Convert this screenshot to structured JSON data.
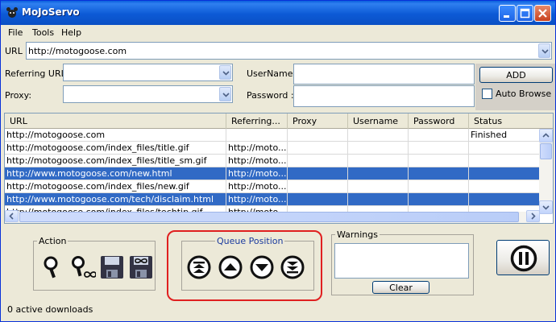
{
  "window": {
    "title": "MoJoServo"
  },
  "menu": [
    "File",
    "Tools",
    "Help"
  ],
  "url_bar": {
    "label": "URL :",
    "value": "http://motogoose.com"
  },
  "form": {
    "referring_url_label": "Referring URL:",
    "proxy_label": "Proxy:",
    "username_label": "UserName :",
    "password_label": "Password :",
    "referring_url_value": "",
    "proxy_value": "",
    "username_value": "",
    "password_value": "",
    "add_label": "ADD",
    "auto_browse_label": "Auto Browse",
    "auto_browse_checked": false
  },
  "table": {
    "columns": [
      "URL",
      "Referring...",
      "Proxy",
      "Username",
      "Password",
      "Status"
    ],
    "rows": [
      {
        "url": "http://motogoose.com",
        "referring": "",
        "proxy": "",
        "username": "",
        "password": "",
        "status": "Finished",
        "selected": false
      },
      {
        "url": "http://motogoose.com/index_files/title.gif",
        "referring": "http://moto...",
        "proxy": "",
        "username": "",
        "password": "",
        "status": "",
        "selected": false
      },
      {
        "url": "http://motogoose.com/index_files/title_sm.gif",
        "referring": "http://moto...",
        "proxy": "",
        "username": "",
        "password": "",
        "status": "",
        "selected": false
      },
      {
        "url": "http://www.motogoose.com/new.html",
        "referring": "http://moto...",
        "proxy": "",
        "username": "",
        "password": "",
        "status": "",
        "selected": true
      },
      {
        "url": "http://motogoose.com/index_files/new.gif",
        "referring": "http://moto...",
        "proxy": "",
        "username": "",
        "password": "",
        "status": "",
        "selected": false
      },
      {
        "url": "http://www.motogoose.com/tech/disclaim.html",
        "referring": "http://moto...",
        "proxy": "",
        "username": "",
        "password": "",
        "status": "",
        "selected": true
      },
      {
        "url": "http://motogoose.com/index_files/techtip.gif",
        "referring": "http://moto...",
        "proxy": "",
        "username": "",
        "password": "",
        "status": "",
        "selected": false
      }
    ]
  },
  "action": {
    "title": "Action",
    "icons": [
      "magnifier-icon",
      "magnifier-infinity-icon",
      "save-icon",
      "save-infinity-icon"
    ]
  },
  "queue": {
    "title": "Queue Position",
    "icons": [
      "move-top-icon",
      "move-up-icon",
      "move-down-icon",
      "move-bottom-icon"
    ]
  },
  "warnings": {
    "title": "Warnings",
    "clear_label": "Clear",
    "text": ""
  },
  "status_bar": {
    "text": "0 active downloads"
  },
  "colors": {
    "accent": "#316ac5",
    "highlight_border": "#e02020",
    "titlebar": "#0a5fdc"
  }
}
